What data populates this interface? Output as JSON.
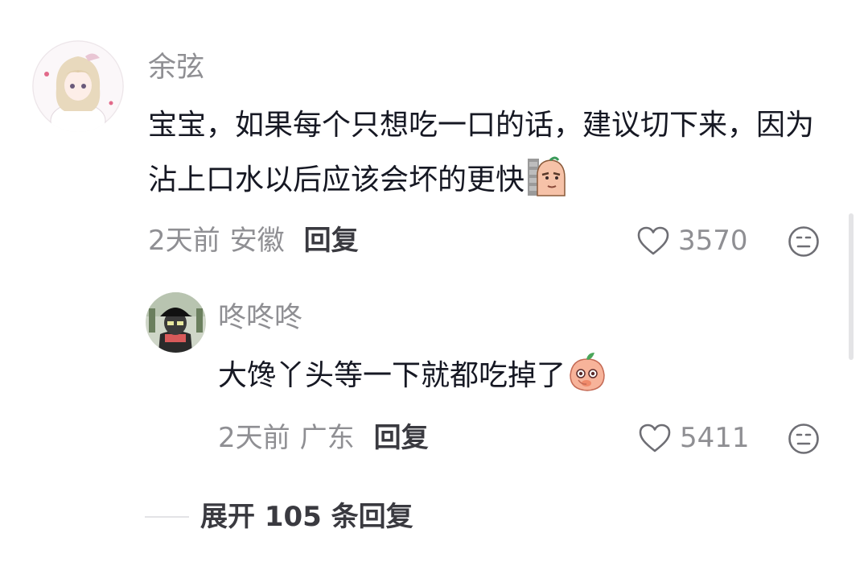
{
  "comment": {
    "username": "余弦",
    "text": "宝宝，如果每个只想吃一口的话，建议切下来，因为沾上口水以后应该会坏的更快",
    "emoji": "peek-wall-emoji",
    "time": "2天前",
    "location": "安徽",
    "reply_label": "回复",
    "likes": "3570"
  },
  "reply": {
    "username": "咚咚咚",
    "text": "大馋丫头等一下就都吃掉了",
    "emoji": "peach-blush-emoji",
    "time": "2天前",
    "location": "广东",
    "reply_label": "回复",
    "likes": "5411"
  },
  "expand_label": "展开 105 条回复",
  "icons": {
    "like": "heart-outline-icon",
    "dislike": "neutral-face-icon"
  },
  "colors": {
    "username": "#8f8f93",
    "text": "#161823",
    "meta": "#8f8f93",
    "reply_button": "#3a3a40"
  }
}
